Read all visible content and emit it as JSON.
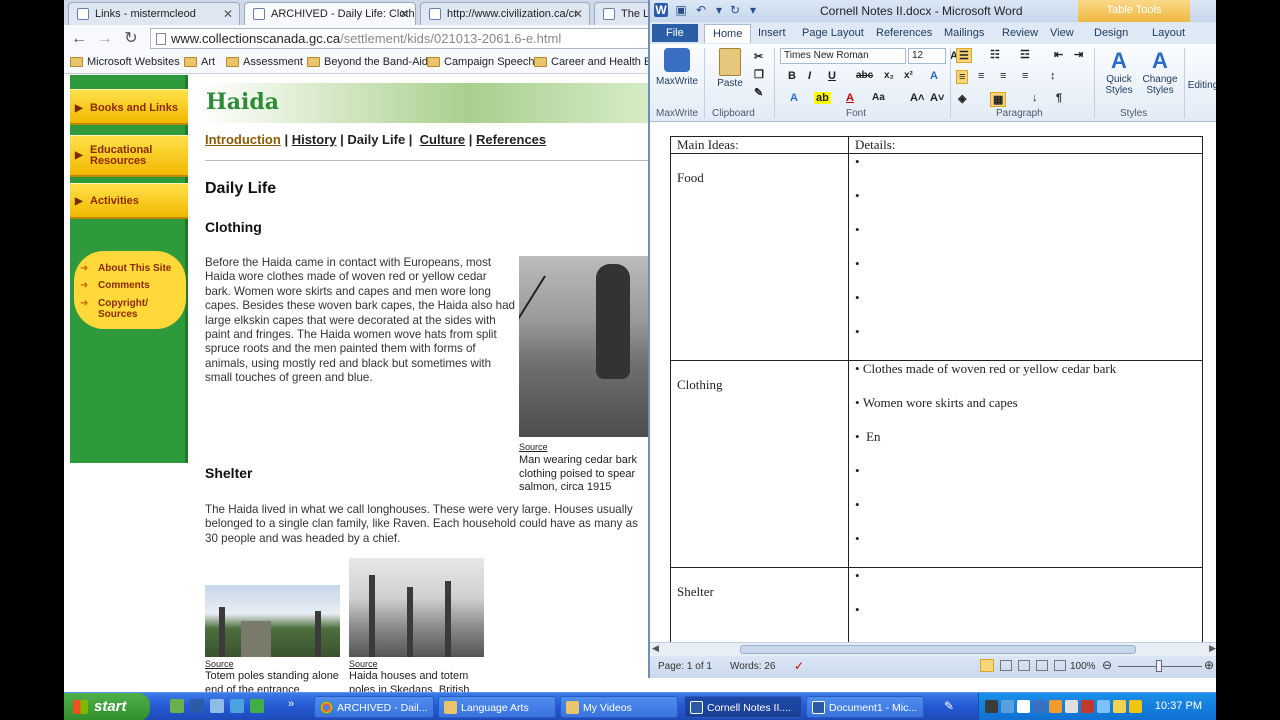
{
  "browser": {
    "tabs": [
      {
        "label": "Links - mistermcleod"
      },
      {
        "label": "ARCHIVED - Daily Life: Clothi"
      },
      {
        "label": "http://www.civilization.ca/cr"
      },
      {
        "label": "The Lea"
      }
    ],
    "url_host": "www.collectionscanada.gc.ca",
    "url_path": "/settlement/kids/021013-2061.6-e.html",
    "bookmarks": [
      "Microsoft Websites",
      "Art",
      "Assessment",
      "Beyond the Band-Aid",
      "Campaign Speech",
      "Career and Health Ed"
    ]
  },
  "site": {
    "brand": "Haida",
    "nav": [
      "Books and Links",
      "Educational Resources",
      "Activities"
    ],
    "nav_small": [
      "About This Site",
      "Comments",
      "Copyright/ Sources"
    ],
    "subnav": {
      "intro": "Introduction",
      "history": "History",
      "daily": "Daily Life",
      "culture": "Culture",
      "references": "References"
    },
    "heading": "Daily Life",
    "clothing_heading": "Clothing",
    "clothing_text": "Before the Haida came in contact with Europeans, most Haida wore clothes made of woven red or yellow cedar bark. Women wore skirts and capes and men wore long capes. Besides these woven bark capes, the Haida also had large elkskin capes that were decorated at the sides with paint and fringes. The Haida women wove hats from split spruce roots and the men painted them with forms of animals, using mostly red and black but sometimes with small touches of green and blue.",
    "source_label": "Source",
    "photo1_caption": "Man wearing cedar bark clothing poised to spear salmon, circa 1915",
    "shelter_heading": "Shelter",
    "shelter_text": "The Haida lived in what we call longhouses. These were very large. Houses usually belonged to a single clan family, like Raven. Each household could have as many as 30 people and was headed by a chief.",
    "photo2_caption": "Totem poles standing alone end of the entrance",
    "photo3_caption": "Haida houses and totem poles in Skedans, British"
  },
  "word": {
    "title": "Cornell Notes II.docx  -  Microsoft Word",
    "table_tools": "Table Tools",
    "tabs": [
      "File",
      "Home",
      "Insert",
      "Page Layout",
      "References",
      "Mailings",
      "Review",
      "View",
      "Design",
      "Layout"
    ],
    "groups": [
      "MaxWrite",
      "Clipboard",
      "Font",
      "Paragraph",
      "Styles"
    ],
    "buttons": {
      "maxwrite": "MaxWrite",
      "paste": "Paste",
      "quick_styles": "Quick Styles",
      "change_styles": "Change Styles",
      "editing": "Editing"
    },
    "font_name": "Times New Roman",
    "font_size": "12",
    "table": {
      "header_main": "Main Ideas:",
      "header_details": "Details:",
      "rows": [
        {
          "idea": "Food",
          "details": [
            "",
            "",
            "",
            "",
            "",
            ""
          ]
        },
        {
          "idea": "Clothing",
          "details": [
            "Clothes made of woven red or yellow  cedar bark",
            "Women wore skirts and capes",
            " En",
            "",
            "",
            ""
          ]
        },
        {
          "idea": "Shelter",
          "details": [
            "",
            ""
          ]
        }
      ]
    },
    "status": {
      "page": "Page: 1 of 1",
      "words": "Words: 26",
      "zoom": "100%"
    }
  },
  "taskbar": {
    "start": "start",
    "buttons": [
      "ARCHIVED - Dail...",
      "Language Arts",
      "My Videos",
      "Cornell Notes II....",
      "Document1 - Mic..."
    ],
    "clock": "10:37 PM"
  }
}
